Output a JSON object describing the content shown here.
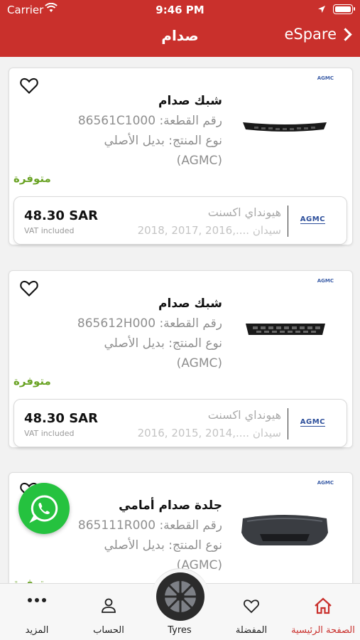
{
  "status_bar": {
    "carrier": "Carrier",
    "time": "9:46 PM"
  },
  "nav": {
    "title": "صدام",
    "back_label": "eSpare"
  },
  "products": [
    {
      "brand": "AGMC",
      "title": "شبك صدام",
      "part_number": "رقم القطعة: 86561C1000",
      "type_line1": "نوع المنتج: بديل الأصلي",
      "type_line2": "(AGMC)",
      "availability": "متوفرة",
      "price": "48.30 SAR",
      "vat": "VAT included",
      "price_brand": "AGMC",
      "vehicle": "هيونداي  اكسنت",
      "years": "سيدان ....,2016 ,2017 ,2018"
    },
    {
      "brand": "AGMC",
      "title": "شبك صدام",
      "part_number": "رقم القطعة: 865612H000",
      "type_line1": "نوع المنتج: بديل الأصلي",
      "type_line2": "(AGMC)",
      "availability": "متوفرة",
      "price": "48.30 SAR",
      "vat": "VAT included",
      "price_brand": "AGMC",
      "vehicle": "هيونداي  اكسنت",
      "years": "سيدان ....,2014 ,2015 ,2016"
    },
    {
      "brand": "AGMC",
      "title": "جلدة صدام أمامي",
      "part_number": "رقم القطعة: 865111R000",
      "type_line1": "نوع المنتج: بديل الأصلي",
      "type_line2": "(AGMC)",
      "availability": "متوفرة"
    }
  ],
  "tabs": {
    "home": "الصفحة الرئيسية",
    "favorites": "المفضلة",
    "tyres": "Tyres",
    "account": "الحساب",
    "more": "المزيد"
  },
  "colors": {
    "brand_red": "#c9302c",
    "available_green": "#6aa325",
    "whatsapp_green": "#25c23f"
  }
}
